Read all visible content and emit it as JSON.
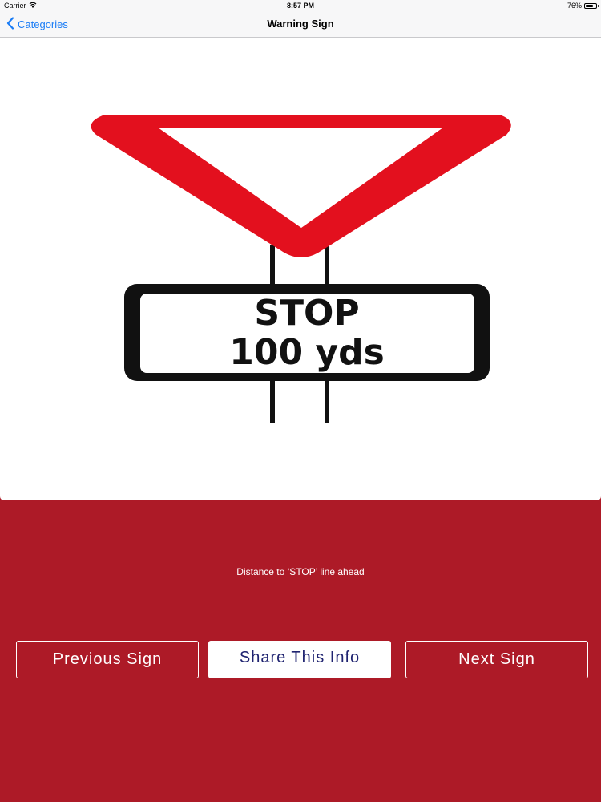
{
  "status_bar": {
    "carrier": "Carrier",
    "time": "8:57 PM",
    "battery_percent": "76%",
    "battery_level": 0.76,
    "wifi_icon": "wifi-icon"
  },
  "nav": {
    "back_label": "Categories",
    "back_icon": "chevron-left-icon",
    "title": "Warning Sign"
  },
  "sign": {
    "line1": "STOP",
    "line2": "100 yds",
    "triangle_color": "#e3101e",
    "post_color": "#111111"
  },
  "description": "Distance to ‘STOP’ line ahead",
  "buttons": {
    "previous": "Previous Sign",
    "share": "Share This Info",
    "next": "Next Sign"
  },
  "colors": {
    "background": "#ad1a27",
    "accent_link": "#1a7cf5",
    "share_text": "#1f2370"
  }
}
